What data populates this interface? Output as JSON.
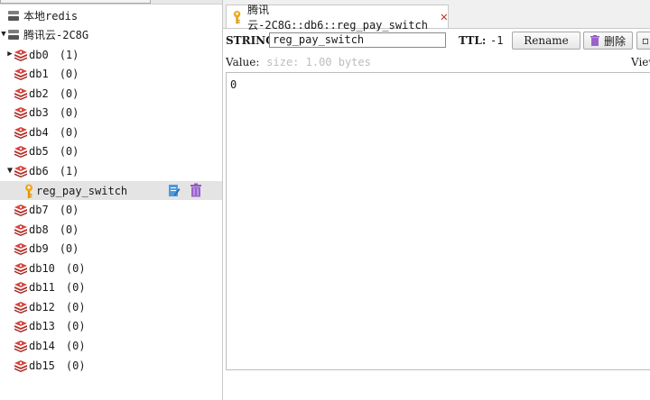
{
  "tree": {
    "local_server": {
      "label": "本地redis"
    },
    "tencent_server": {
      "label": "腾讯云-2C8G"
    },
    "databases": [
      {
        "label": "db0",
        "count": "(1)"
      },
      {
        "label": "db1",
        "count": "(0)"
      },
      {
        "label": "db2",
        "count": "(0)"
      },
      {
        "label": "db3",
        "count": "(0)"
      },
      {
        "label": "db4",
        "count": "(0)"
      },
      {
        "label": "db5",
        "count": "(0)"
      },
      {
        "label": "db6",
        "count": "(1)"
      },
      {
        "label": "db7",
        "count": "(0)"
      },
      {
        "label": "db8",
        "count": "(0)"
      },
      {
        "label": "db9",
        "count": "(0)"
      },
      {
        "label": "db10",
        "count": "(0)"
      },
      {
        "label": "db11",
        "count": "(0)"
      },
      {
        "label": "db12",
        "count": "(0)"
      },
      {
        "label": "db13",
        "count": "(0)"
      },
      {
        "label": "db14",
        "count": "(0)"
      },
      {
        "label": "db15",
        "count": "(0)"
      }
    ],
    "selected_key": {
      "label": "reg_pay_switch"
    }
  },
  "tab": {
    "title": "腾讯云-2C8G::db6::reg_pay_switch"
  },
  "editor": {
    "type_label": "STRING:",
    "key_value": "reg_pay_switch",
    "ttl_label": "TTL:",
    "ttl_value": "-1",
    "rename_label": "Rename",
    "delete_label": "删除",
    "value_label": "Value:",
    "value_size": "size: 1.00 bytes",
    "view_as_label": "View",
    "content": "0"
  },
  "colors": {
    "db_icon": "#c0392b",
    "key_icon": "#e6a117",
    "edit_icon": "#3b8fd6",
    "trash_icon": "#8e5bbf",
    "selection": "#e4e4e4"
  }
}
